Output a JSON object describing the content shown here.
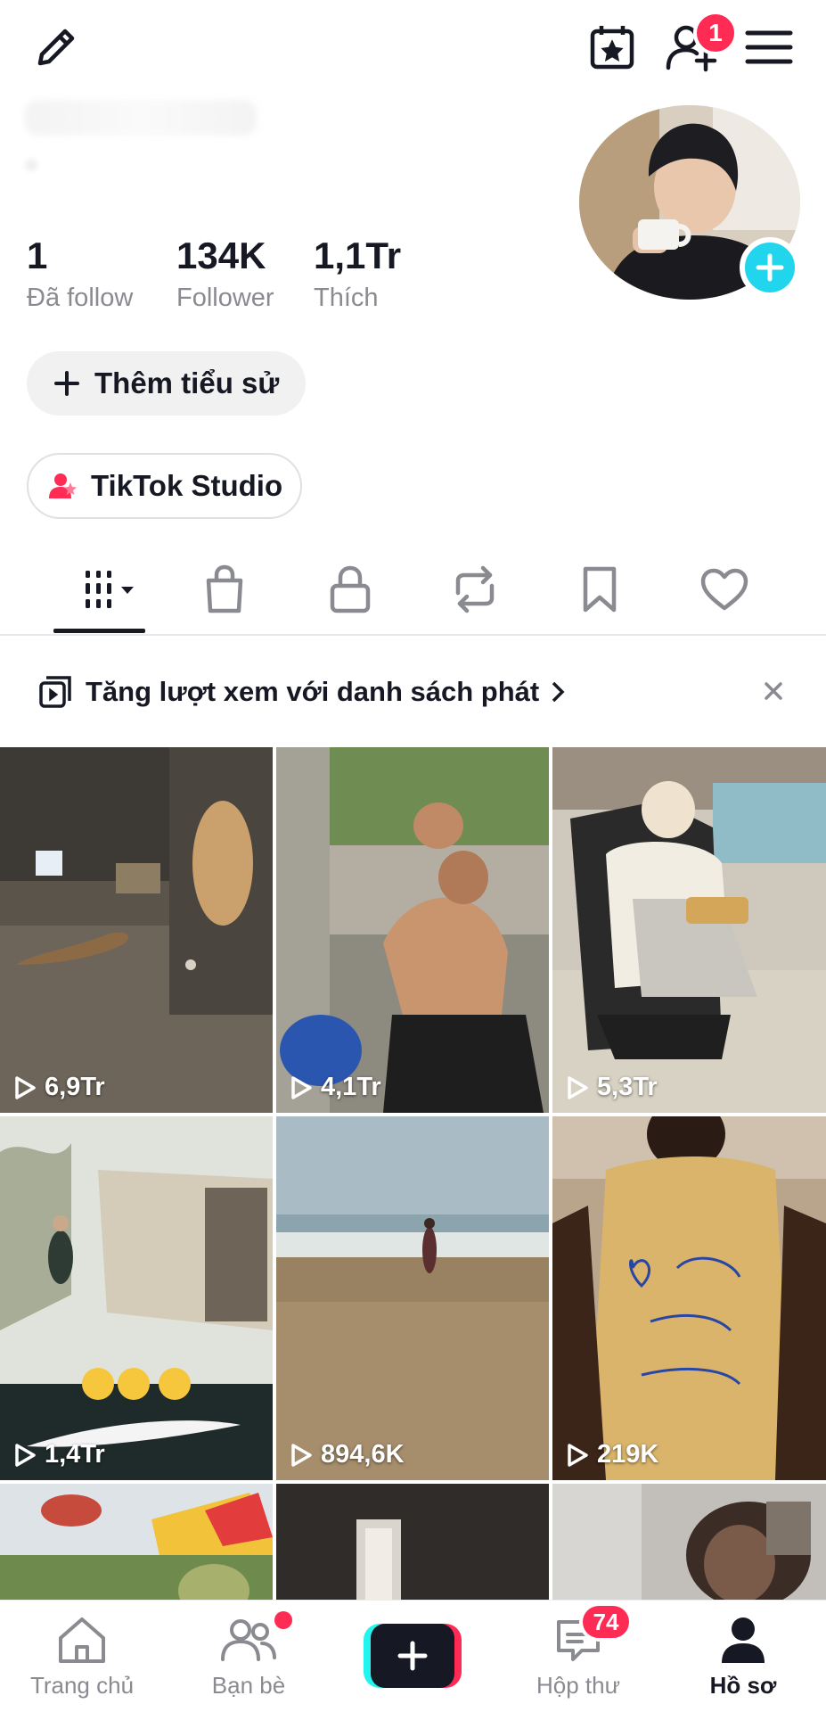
{
  "header": {
    "badge_friends_count": "1"
  },
  "profile": {
    "stats": [
      {
        "value": "1",
        "label": "Đã follow"
      },
      {
        "value": "134K",
        "label": "Follower"
      },
      {
        "value": "1,1Tr",
        "label": "Thích"
      }
    ],
    "add_bio_label": "Thêm tiểu sử",
    "studio_label": "TikTok Studio"
  },
  "tabs": [
    "videos-tab",
    "shop-tab",
    "private-tab",
    "reposts-tab",
    "favorites-tab",
    "liked-tab"
  ],
  "banner": {
    "text": "Tăng lượt xem với danh sách phát"
  },
  "videos": [
    {
      "views": "6,9Tr"
    },
    {
      "views": "4,1Tr"
    },
    {
      "views": "5,3Tr"
    },
    {
      "views": "1,4Tr"
    },
    {
      "views": "894,6K"
    },
    {
      "views": "219K"
    },
    {
      "views": ""
    },
    {
      "views": ""
    },
    {
      "views": ""
    }
  ],
  "bottom_nav": {
    "home": "Trang chủ",
    "friends": "Bạn bè",
    "inbox": "Hộp thư",
    "inbox_badge": "74",
    "profile": "Hồ sơ"
  },
  "colors": {
    "accent": "#fe2c55",
    "cyan": "#20d5ec",
    "text": "#161823",
    "muted": "#8a8b91"
  }
}
